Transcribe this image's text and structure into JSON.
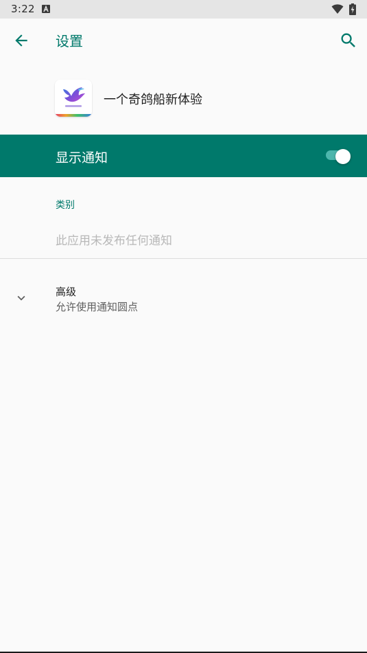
{
  "status_bar": {
    "time": "3:22",
    "icons": [
      "notification-a-icon",
      "wifi-icon",
      "battery-charging-icon"
    ]
  },
  "app_bar": {
    "title": "设置",
    "back_icon": "arrow-back-icon",
    "search_icon": "search-icon"
  },
  "app": {
    "name": "一个奇鸽船新体验",
    "icon": "app-logo-bird"
  },
  "notifications_toggle": {
    "label": "显示通知",
    "enabled": true
  },
  "categories": {
    "header": "类别",
    "empty_message": "此应用未发布任何通知"
  },
  "advanced": {
    "title": "高级",
    "summary": "允许使用通知圆点",
    "icon": "chevron-down-icon"
  },
  "colors": {
    "accent": "#00796b",
    "switch_track": "#4db6ac",
    "background": "#fafafa",
    "status_bar": "#e5e5e5"
  }
}
